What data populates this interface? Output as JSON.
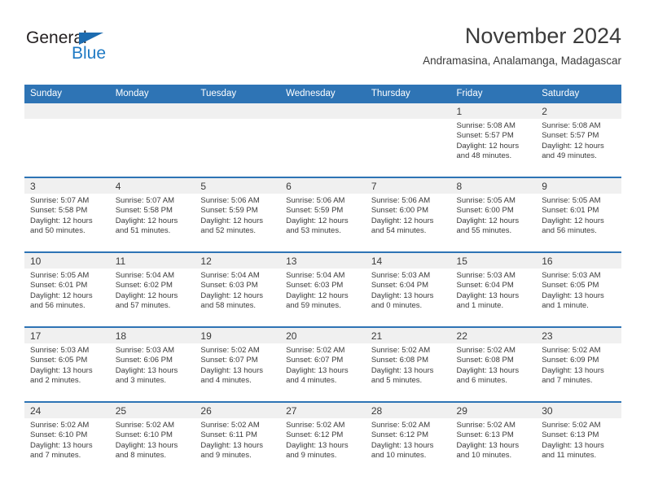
{
  "brand": {
    "name_part1": "General",
    "name_part2": "Blue",
    "triangle_icon": "blue-triangle-icon",
    "color_dark": "#231f20",
    "color_blue": "#1f7ac4"
  },
  "header": {
    "title": "November 2024",
    "subtitle": "Andramasina, Analamanga, Madagascar"
  },
  "theme": {
    "header_row_bg": "#2e74b5",
    "date_bar_bg": "#f0f0f0",
    "row_border": "#2e74b5",
    "text": "#3a3a3a"
  },
  "weekday_headers": [
    "Sunday",
    "Monday",
    "Tuesday",
    "Wednesday",
    "Thursday",
    "Friday",
    "Saturday"
  ],
  "weeks": [
    [
      {
        "blank": true
      },
      {
        "blank": true
      },
      {
        "blank": true
      },
      {
        "blank": true
      },
      {
        "blank": true
      },
      {
        "day": "1",
        "sunrise": "Sunrise: 5:08 AM",
        "sunset": "Sunset: 5:57 PM",
        "daylight": "Daylight: 12 hours and 48 minutes."
      },
      {
        "day": "2",
        "sunrise": "Sunrise: 5:08 AM",
        "sunset": "Sunset: 5:57 PM",
        "daylight": "Daylight: 12 hours and 49 minutes."
      }
    ],
    [
      {
        "day": "3",
        "sunrise": "Sunrise: 5:07 AM",
        "sunset": "Sunset: 5:58 PM",
        "daylight": "Daylight: 12 hours and 50 minutes."
      },
      {
        "day": "4",
        "sunrise": "Sunrise: 5:07 AM",
        "sunset": "Sunset: 5:58 PM",
        "daylight": "Daylight: 12 hours and 51 minutes."
      },
      {
        "day": "5",
        "sunrise": "Sunrise: 5:06 AM",
        "sunset": "Sunset: 5:59 PM",
        "daylight": "Daylight: 12 hours and 52 minutes."
      },
      {
        "day": "6",
        "sunrise": "Sunrise: 5:06 AM",
        "sunset": "Sunset: 5:59 PM",
        "daylight": "Daylight: 12 hours and 53 minutes."
      },
      {
        "day": "7",
        "sunrise": "Sunrise: 5:06 AM",
        "sunset": "Sunset: 6:00 PM",
        "daylight": "Daylight: 12 hours and 54 minutes."
      },
      {
        "day": "8",
        "sunrise": "Sunrise: 5:05 AM",
        "sunset": "Sunset: 6:00 PM",
        "daylight": "Daylight: 12 hours and 55 minutes."
      },
      {
        "day": "9",
        "sunrise": "Sunrise: 5:05 AM",
        "sunset": "Sunset: 6:01 PM",
        "daylight": "Daylight: 12 hours and 56 minutes."
      }
    ],
    [
      {
        "day": "10",
        "sunrise": "Sunrise: 5:05 AM",
        "sunset": "Sunset: 6:01 PM",
        "daylight": "Daylight: 12 hours and 56 minutes."
      },
      {
        "day": "11",
        "sunrise": "Sunrise: 5:04 AM",
        "sunset": "Sunset: 6:02 PM",
        "daylight": "Daylight: 12 hours and 57 minutes."
      },
      {
        "day": "12",
        "sunrise": "Sunrise: 5:04 AM",
        "sunset": "Sunset: 6:03 PM",
        "daylight": "Daylight: 12 hours and 58 minutes."
      },
      {
        "day": "13",
        "sunrise": "Sunrise: 5:04 AM",
        "sunset": "Sunset: 6:03 PM",
        "daylight": "Daylight: 12 hours and 59 minutes."
      },
      {
        "day": "14",
        "sunrise": "Sunrise: 5:03 AM",
        "sunset": "Sunset: 6:04 PM",
        "daylight": "Daylight: 13 hours and 0 minutes."
      },
      {
        "day": "15",
        "sunrise": "Sunrise: 5:03 AM",
        "sunset": "Sunset: 6:04 PM",
        "daylight": "Daylight: 13 hours and 1 minute."
      },
      {
        "day": "16",
        "sunrise": "Sunrise: 5:03 AM",
        "sunset": "Sunset: 6:05 PM",
        "daylight": "Daylight: 13 hours and 1 minute."
      }
    ],
    [
      {
        "day": "17",
        "sunrise": "Sunrise: 5:03 AM",
        "sunset": "Sunset: 6:05 PM",
        "daylight": "Daylight: 13 hours and 2 minutes."
      },
      {
        "day": "18",
        "sunrise": "Sunrise: 5:03 AM",
        "sunset": "Sunset: 6:06 PM",
        "daylight": "Daylight: 13 hours and 3 minutes."
      },
      {
        "day": "19",
        "sunrise": "Sunrise: 5:02 AM",
        "sunset": "Sunset: 6:07 PM",
        "daylight": "Daylight: 13 hours and 4 minutes."
      },
      {
        "day": "20",
        "sunrise": "Sunrise: 5:02 AM",
        "sunset": "Sunset: 6:07 PM",
        "daylight": "Daylight: 13 hours and 4 minutes."
      },
      {
        "day": "21",
        "sunrise": "Sunrise: 5:02 AM",
        "sunset": "Sunset: 6:08 PM",
        "daylight": "Daylight: 13 hours and 5 minutes."
      },
      {
        "day": "22",
        "sunrise": "Sunrise: 5:02 AM",
        "sunset": "Sunset: 6:08 PM",
        "daylight": "Daylight: 13 hours and 6 minutes."
      },
      {
        "day": "23",
        "sunrise": "Sunrise: 5:02 AM",
        "sunset": "Sunset: 6:09 PM",
        "daylight": "Daylight: 13 hours and 7 minutes."
      }
    ],
    [
      {
        "day": "24",
        "sunrise": "Sunrise: 5:02 AM",
        "sunset": "Sunset: 6:10 PM",
        "daylight": "Daylight: 13 hours and 7 minutes."
      },
      {
        "day": "25",
        "sunrise": "Sunrise: 5:02 AM",
        "sunset": "Sunset: 6:10 PM",
        "daylight": "Daylight: 13 hours and 8 minutes."
      },
      {
        "day": "26",
        "sunrise": "Sunrise: 5:02 AM",
        "sunset": "Sunset: 6:11 PM",
        "daylight": "Daylight: 13 hours and 9 minutes."
      },
      {
        "day": "27",
        "sunrise": "Sunrise: 5:02 AM",
        "sunset": "Sunset: 6:12 PM",
        "daylight": "Daylight: 13 hours and 9 minutes."
      },
      {
        "day": "28",
        "sunrise": "Sunrise: 5:02 AM",
        "sunset": "Sunset: 6:12 PM",
        "daylight": "Daylight: 13 hours and 10 minutes."
      },
      {
        "day": "29",
        "sunrise": "Sunrise: 5:02 AM",
        "sunset": "Sunset: 6:13 PM",
        "daylight": "Daylight: 13 hours and 10 minutes."
      },
      {
        "day": "30",
        "sunrise": "Sunrise: 5:02 AM",
        "sunset": "Sunset: 6:13 PM",
        "daylight": "Daylight: 13 hours and 11 minutes."
      }
    ]
  ]
}
